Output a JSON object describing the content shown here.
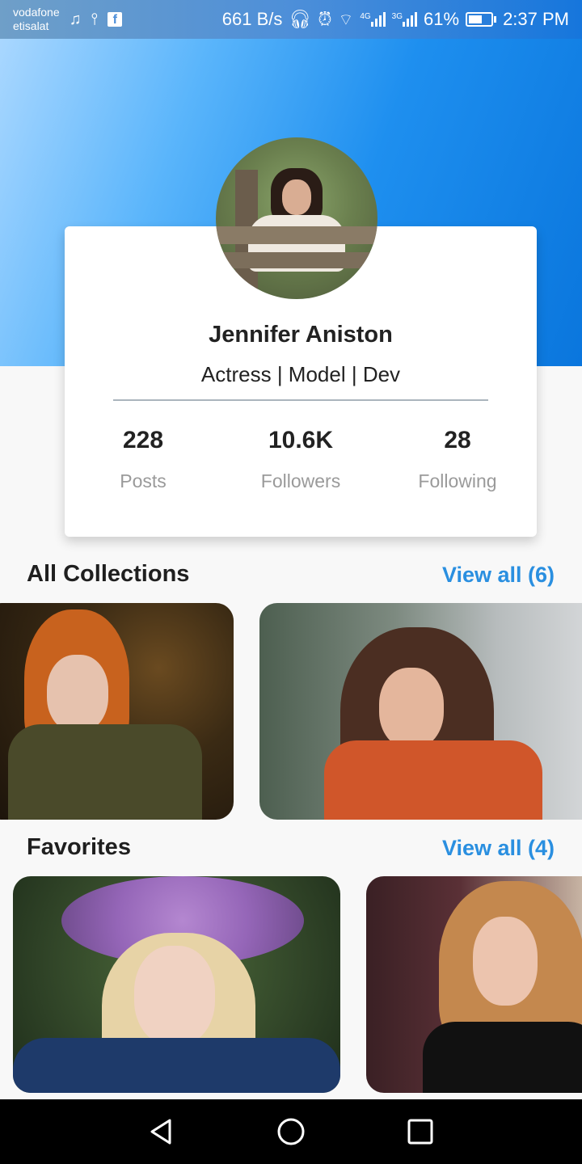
{
  "status_bar": {
    "carrier_1": "vodafone",
    "carrier_2": "etisalat",
    "net_speed": "661 B/s",
    "network_1": "4G",
    "network_2": "3G",
    "battery": "61%",
    "battery_level": 0.61,
    "time": "2:37 PM",
    "left_icons": [
      "music-note-icon",
      "usb-icon",
      "facebook-icon"
    ],
    "right_icons": [
      "headset-icon",
      "alarm-icon",
      "wifi-icon",
      "signal-icon",
      "signal-icon",
      "battery-charging-icon"
    ]
  },
  "profile": {
    "name": "Jennifer Aniston",
    "tagline": "Actress | Model | Dev",
    "stats": [
      {
        "value": "228",
        "label": "Posts"
      },
      {
        "value": "10.6K",
        "label": "Followers"
      },
      {
        "value": "28",
        "label": "Following"
      }
    ]
  },
  "collections": {
    "title": "All Collections",
    "view_all": "View all (6)"
  },
  "favorites": {
    "title": "Favorites",
    "view_all": "View all (4)"
  },
  "nav_bar": {
    "icons": [
      "back-triangle-icon",
      "home-circle-icon",
      "recents-square-icon"
    ]
  },
  "colors": {
    "accent": "#2a8fe0",
    "header_start": "#a9d7ff",
    "header_end": "#0a76dd"
  }
}
